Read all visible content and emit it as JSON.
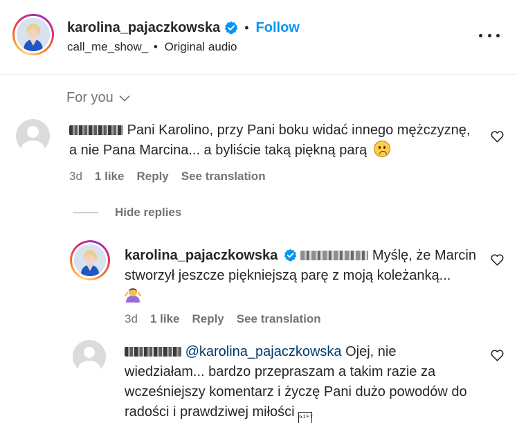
{
  "header": {
    "username": "karolina_pajaczkowska",
    "separator": "•",
    "follow_label": "Follow",
    "audio_author": "call_me_show_",
    "audio_separator": "•",
    "audio_label": "Original audio",
    "verified_icon": "verified-badge-icon",
    "menu_icon": "more-options-icon"
  },
  "sort": {
    "label": "For you",
    "icon": "chevron-down-icon"
  },
  "comments": [
    {
      "text": "Pani Karolino, przy Pani boku widać innego mężczyznę, a nie Pana Marcina... a byliście taką piękną parą",
      "emoji": "worried-face-emoji",
      "age": "3d",
      "likes": "1 like",
      "reply_label": "Reply",
      "translation_label": "See translation",
      "like_icon": "heart-icon"
    }
  ],
  "hide_replies_label": "Hide replies",
  "replies": [
    {
      "username": "karolina_pajaczkowska",
      "text": "Myślę, że Marcin stworzył jeszcze piękniejszą parę z moją koleżanką...",
      "emoji": "shrug-emoji",
      "age": "3d",
      "likes": "1 like",
      "reply_label": "Reply",
      "translation_label": "See translation",
      "like_icon": "heart-icon"
    },
    {
      "mention": "@karolina_pajaczkowska",
      "text_line1": "Ojej, nie",
      "text_rest": "wiedziałam... bardzo przepraszam a takim razie za wcześniejszy komentarz i życzę Pani dużo powodów do radości i prawdziwej miłości",
      "gift_glyph": "GIFT",
      "like_icon": "heart-icon"
    }
  ],
  "colors": {
    "accent": "#0095f6",
    "text": "#262626",
    "secondary": "#737373",
    "mention": "#00376b"
  }
}
